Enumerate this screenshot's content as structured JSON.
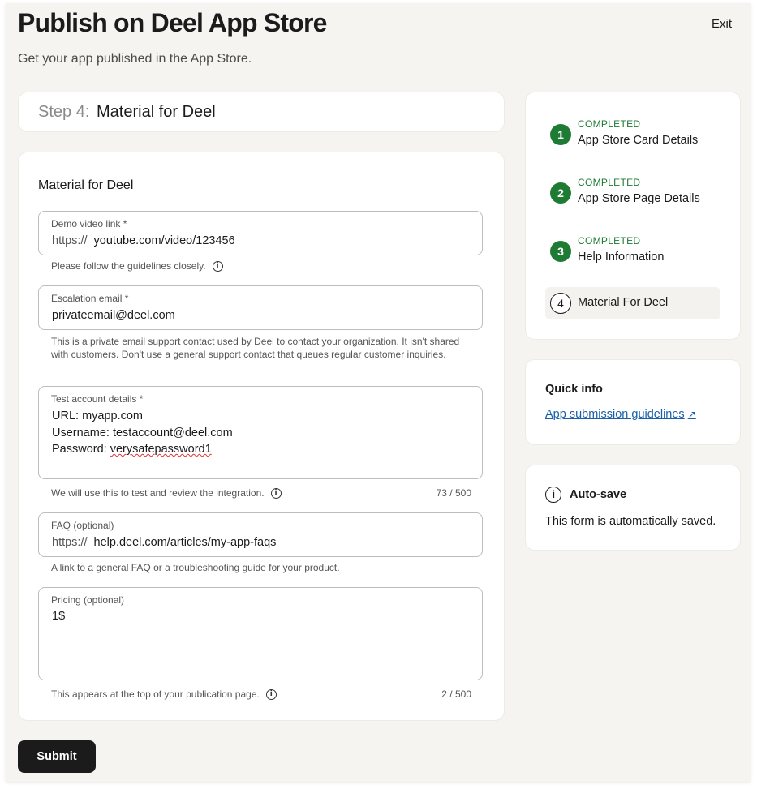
{
  "header": {
    "title": "Publish on Deel App Store",
    "subtitle": "Get your app published in the App Store.",
    "exit_label": "Exit"
  },
  "step_card": {
    "prefix": "Step 4:",
    "name": "Material for Deel"
  },
  "form": {
    "section_title": "Material for Deel",
    "demo_video": {
      "label": "Demo video link *",
      "prefix": "https://",
      "value": "youtube.com/video/123456",
      "helper": "Please follow the guidelines closely."
    },
    "escalation_email": {
      "label": "Escalation email *",
      "value": "privateemail@deel.com",
      "helper": "This is a private email support contact used by Deel to contact your organization. It isn't shared with customers. Don't use a general support contact that queues regular customer inquiries."
    },
    "test_account": {
      "label": "Test account details *",
      "line1": "URL: myapp.com",
      "line2": "Username: testaccount@deel.com",
      "line3_prefix": "Password: ",
      "line3_value": "verysafepassword1",
      "helper": "We will use this to test and review the integration.",
      "counter": "73 / 500"
    },
    "faq": {
      "label": "FAQ (optional)",
      "prefix": "https://",
      "value": "help.deel.com/articles/my-app-faqs",
      "helper": "A link to a general FAQ or a troubleshooting guide for your product."
    },
    "pricing": {
      "label": "Pricing (optional)",
      "value": "1$",
      "helper": "This appears at the top of your publication page.",
      "counter": "2 / 500"
    }
  },
  "steps": [
    {
      "number": "1",
      "status": "COMPLETED",
      "title": "App Store Card Details"
    },
    {
      "number": "2",
      "status": "COMPLETED",
      "title": "App Store Page Details"
    },
    {
      "number": "3",
      "status": "COMPLETED",
      "title": "Help Information"
    },
    {
      "number": "4",
      "status": "",
      "title": "Material For Deel"
    }
  ],
  "quick_info": {
    "title": "Quick info",
    "link_label": "App submission guidelines"
  },
  "autosave": {
    "title": "Auto-save",
    "text": "This form is automatically saved."
  },
  "submit_label": "Submit",
  "colors": {
    "completed_green": "#1e7b34",
    "link_blue": "#1a5fa8",
    "primary_button": "#1b1b1b",
    "page_background": "#f5f4f0"
  },
  "icons": {
    "info": "info-icon",
    "external_link": "external-link-icon",
    "autosave": "info-circle-icon"
  }
}
